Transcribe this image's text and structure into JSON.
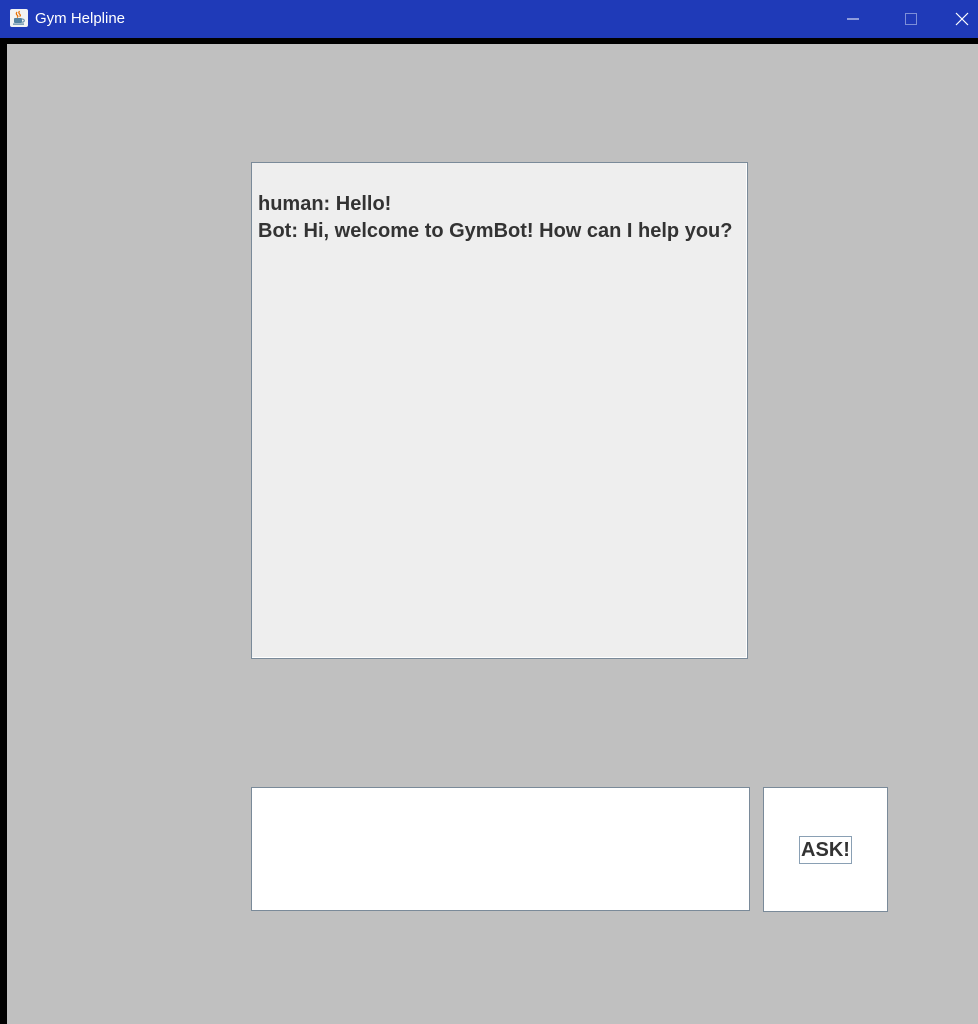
{
  "window": {
    "title": "Gym Helpline",
    "app_icon": "java-cup-icon",
    "controls": [
      "minimize-icon",
      "maximize-icon",
      "close-icon"
    ]
  },
  "chat": {
    "lines": [
      "human: Hello!",
      "Bot: Hi, welcome to GymBot! How can I help you?"
    ]
  },
  "input": {
    "value": "",
    "placeholder": ""
  },
  "ask_button": {
    "label": "ASK!"
  },
  "colors": {
    "titlebar": "#1f3ab8",
    "background": "#c0c0c0",
    "chat_background": "#eeeeee",
    "text": "#333333"
  }
}
